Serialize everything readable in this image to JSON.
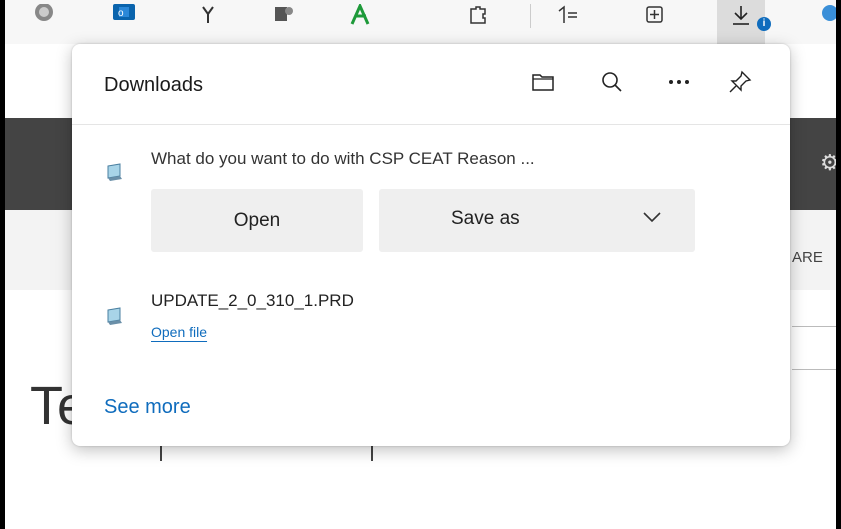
{
  "flyout": {
    "title": "Downloads",
    "header_icons": [
      "folder-icon",
      "search-icon",
      "more-icon",
      "pin-icon"
    ],
    "pending_download": {
      "prompt": "What do you want to do with CSP CEAT Reason ...",
      "open_label": "Open",
      "save_as_label": "Save as"
    },
    "completed_download": {
      "filename": "UPDATE_2_0_310_1.PRD",
      "open_file_label": "Open file"
    },
    "see_more_label": "See more"
  },
  "background": {
    "are_text": "ARE",
    "te_text": "Te"
  },
  "colors": {
    "accent": "#0f6cbd",
    "button_bg": "#efefef",
    "dark_bar": "#444444"
  }
}
